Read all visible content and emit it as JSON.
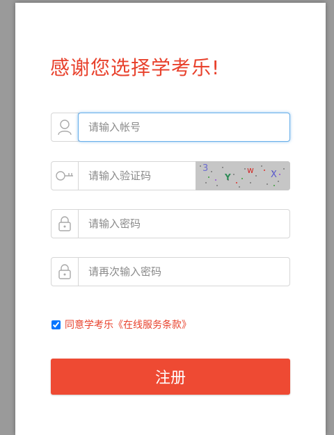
{
  "title": "感谢您选择学考乐!",
  "fields": {
    "account": {
      "placeholder": "请输入帐号",
      "value": ""
    },
    "captcha": {
      "placeholder": "请输入验证码",
      "value": "",
      "image_chars": [
        "3",
        "Y",
        "w",
        "X"
      ]
    },
    "password": {
      "placeholder": "请输入密码",
      "value": ""
    },
    "confirm_password": {
      "placeholder": "请再次输入密码",
      "value": ""
    }
  },
  "agreement": {
    "label": "同意学考乐《在线服务条款》",
    "checked": true
  },
  "submit_label": "注册",
  "colors": {
    "accent": "#ee4a33",
    "title": "#e8412c",
    "focus": "#66aeea"
  },
  "icons": {
    "account": "user-icon",
    "captcha": "key-icon",
    "password": "lock-icon",
    "confirm_password": "lock-icon"
  }
}
